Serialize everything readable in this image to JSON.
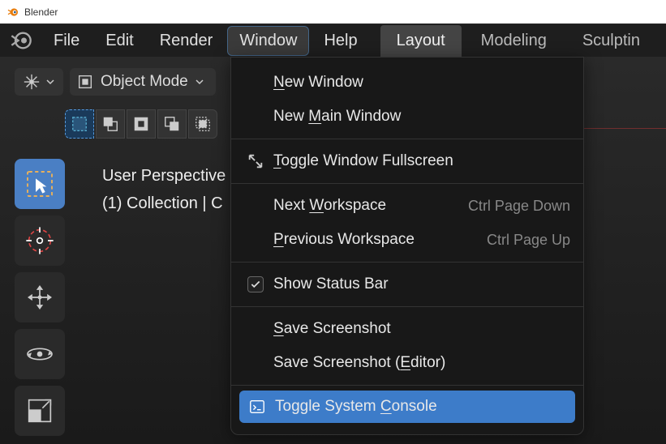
{
  "titlebar": {
    "title": "Blender"
  },
  "topbar": {
    "menus": {
      "file": "File",
      "edit": "Edit",
      "render": "Render",
      "window": "Window",
      "help": "Help"
    },
    "tabs": {
      "layout": "Layout",
      "modeling": "Modeling",
      "sculpting": "Sculptin"
    }
  },
  "toolbar": {
    "mode": "Object Mode"
  },
  "viewport": {
    "line1": "User Perspective",
    "line2": "(1) Collection | C"
  },
  "window_menu": {
    "new_window": "New Window",
    "new_main_window": "New Main Window",
    "toggle_fullscreen": "Toggle Window Fullscreen",
    "next_workspace": "Next Workspace",
    "next_workspace_sc": "Ctrl Page Down",
    "prev_workspace": "Previous Workspace",
    "prev_workspace_sc": "Ctrl Page Up",
    "show_status_bar": "Show Status Bar",
    "save_screenshot": "Save Screenshot",
    "save_screenshot_editor": "Save Screenshot (Editor)",
    "toggle_console": "Toggle System Console"
  }
}
